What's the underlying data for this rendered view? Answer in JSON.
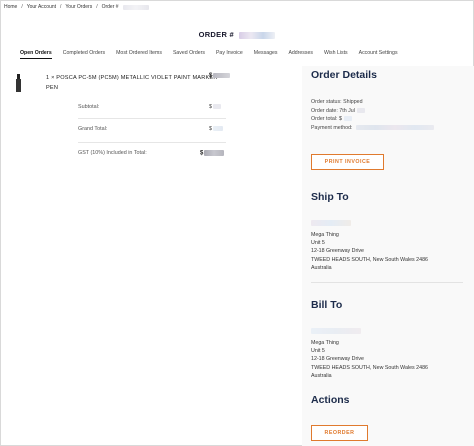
{
  "breadcrumb": {
    "items": [
      "Home",
      "Your Account",
      "Your Orders",
      "Order #"
    ],
    "separator": "/"
  },
  "page_title": "ORDER #",
  "tabs": [
    "Open Orders",
    "Completed Orders",
    "Most Ordered Items",
    "Saved Orders",
    "Pay Invoice",
    "Messages",
    "Addresses",
    "Wish Lists",
    "Account Settings"
  ],
  "item": {
    "name": "1 × POSCA PC-5M (PC5M) METALLIC VIOLET PAINT MARKER PEN",
    "price_prefix": "$"
  },
  "summary": {
    "subtotal_label": "Subtotal:",
    "grand_total_label": "Grand Total:",
    "gst_label": "GST (10%) Included in Total:",
    "currency": "$"
  },
  "order_details": {
    "title": "Order Details",
    "status_label": "Order status:",
    "status_value": "Shipped",
    "date_label": "Order date:",
    "date_value": "7th Jul",
    "total_label": "Order total:",
    "total_value": "$",
    "payment_label": "Payment method:",
    "print_button": "PRINT INVOICE"
  },
  "ship_to": {
    "title": "Ship To",
    "lines": [
      "Mega Thing",
      "Unit 5",
      "12-18 Greenway Drive",
      "TWEED HEADS SOUTH, New South Wales 2486",
      "Australia"
    ]
  },
  "bill_to": {
    "title": "Bill To",
    "lines": [
      "Mega Thing",
      "Unit 5",
      "12-18 Greenway Drive",
      "TWEED HEADS SOUTH, New South Wales 2486",
      "Australia"
    ]
  },
  "actions": {
    "title": "Actions",
    "reorder_button": "REORDER"
  },
  "colors": {
    "accent_orange": "#e07a2e",
    "heading_navy": "#1c2b4a"
  }
}
